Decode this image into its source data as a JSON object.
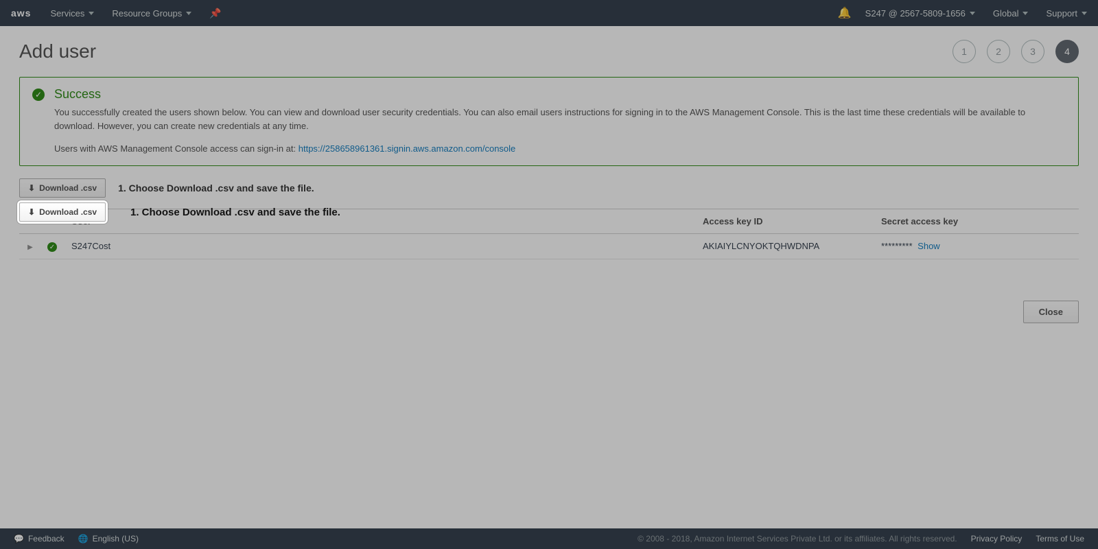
{
  "nav": {
    "services_label": "Services",
    "resource_groups_label": "Resource Groups",
    "account_label": "S247 @ 2567-5809-1656",
    "region_label": "Global",
    "support_label": "Support"
  },
  "page": {
    "title": "Add user",
    "steps": [
      "1",
      "2",
      "3",
      "4"
    ],
    "current_step_index": 3
  },
  "alert": {
    "heading": "Success",
    "body": "You successfully created the users shown below. You can view and download user security credentials. You can also email users instructions for signing in to the AWS Management Console. This is the last time these credentials will be available to download. However, you can create new credentials at any time.",
    "signin_prefix": "Users with AWS Management Console access can sign-in at: ",
    "signin_url": "https://258658961361.signin.aws.amazon.com/console"
  },
  "download": {
    "button_label": "Download .csv"
  },
  "callout": {
    "text": "1. Choose Download .csv and save the file."
  },
  "table": {
    "headers": {
      "user": "User",
      "access_key_id": "Access key ID",
      "secret_access_key": "Secret access key"
    },
    "rows": [
      {
        "user": "S247Cost",
        "access_key_id": "AKIAIYLCNYOKTQHWDNPA",
        "secret_masked": "*********",
        "show_label": "Show"
      }
    ]
  },
  "close_label": "Close",
  "footer": {
    "feedback_label": "Feedback",
    "language_label": "English (US)",
    "copyright": "© 2008 - 2018, Amazon Internet Services Private Ltd. or its affiliates. All rights reserved.",
    "privacy_label": "Privacy Policy",
    "terms_label": "Terms of Use"
  }
}
